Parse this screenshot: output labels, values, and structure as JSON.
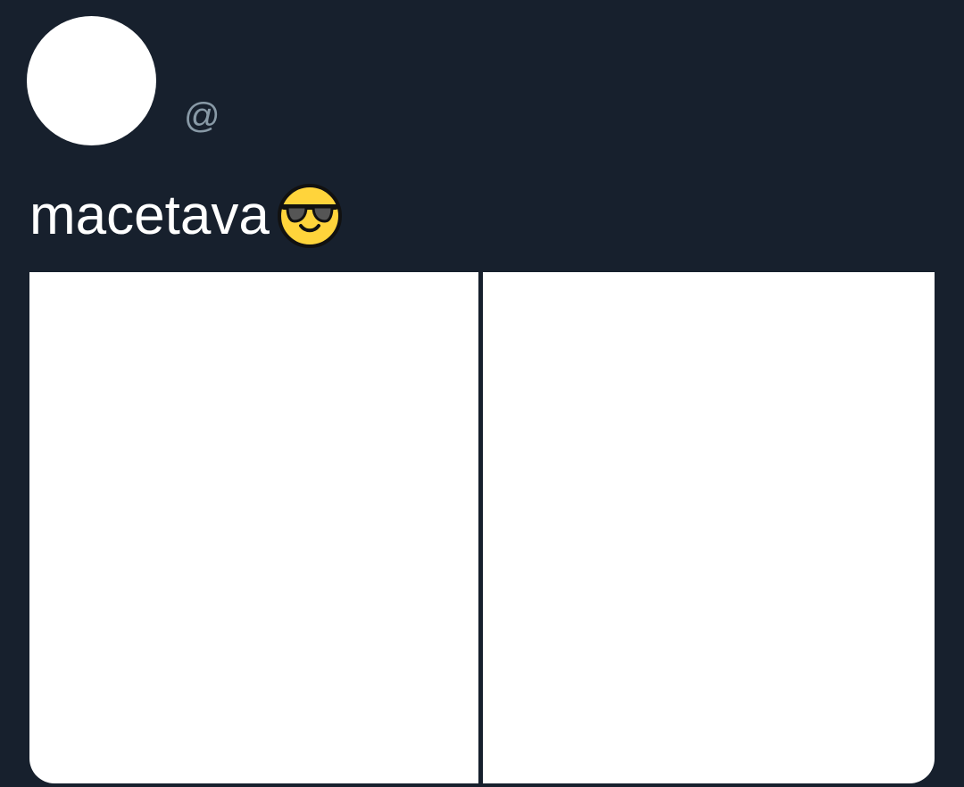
{
  "tweet": {
    "display_name": "",
    "handle": "@",
    "text": "macetava",
    "emoji": "smiling-face-with-sunglasses",
    "images": [
      {
        "name": "media-image-left"
      },
      {
        "name": "media-image-right"
      }
    ]
  },
  "theme": {
    "background": "#17202d",
    "text": "#ffffff",
    "muted_text": "#8899a6",
    "media": "#ffffff"
  }
}
